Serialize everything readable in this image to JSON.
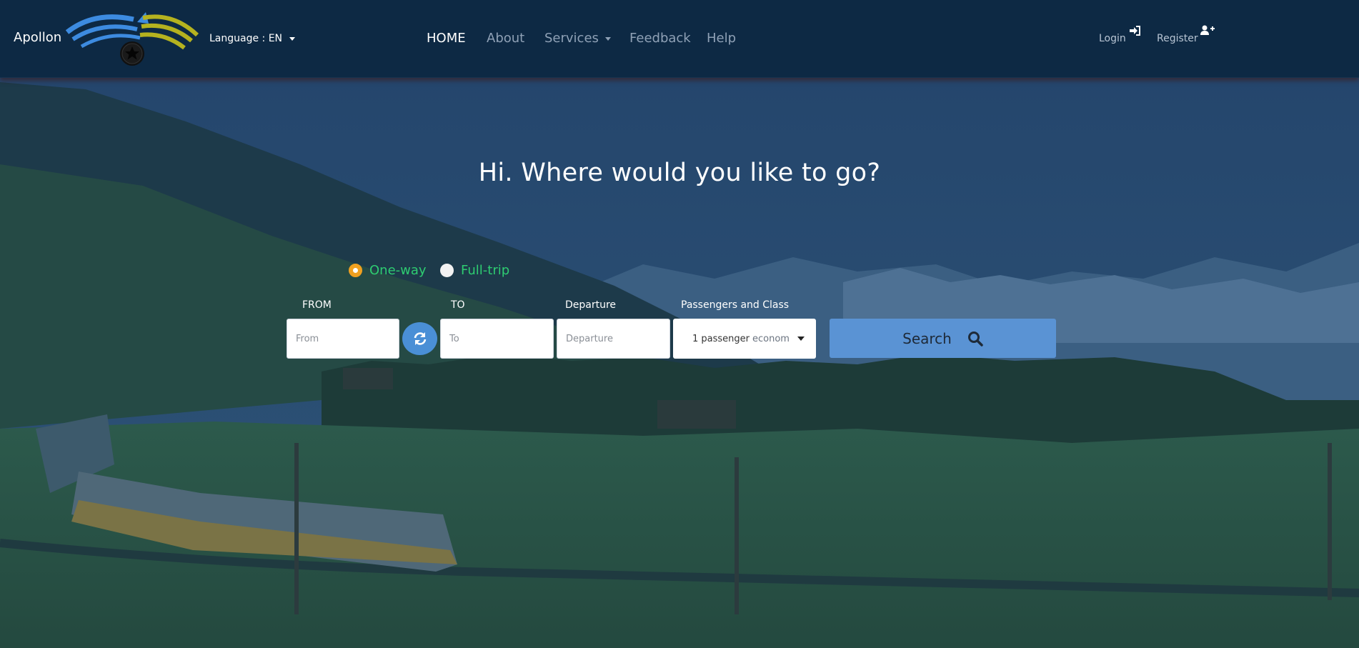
{
  "header": {
    "brand": "Apollon",
    "language_label": "Language : EN",
    "nav": [
      {
        "label": "HOME",
        "active": true
      },
      {
        "label": "About"
      },
      {
        "label": "Services",
        "has_dropdown": true
      },
      {
        "label": "Feedback"
      },
      {
        "label": "Help"
      }
    ],
    "login_label": "Login",
    "register_label": "Register"
  },
  "hero": {
    "title": "Hi. Where would you like to go?"
  },
  "search_form": {
    "trip_types": [
      {
        "label": "One-way",
        "selected": true
      },
      {
        "label": "Full-trip",
        "selected": false
      }
    ],
    "from_label": "FROM",
    "from_placeholder": "From",
    "to_label": "TO",
    "to_placeholder": "To",
    "departure_label": "Departure",
    "departure_placeholder": "Departure",
    "passengers_label": "Passengers and Class",
    "passengers_value": "1 passenger",
    "class_value": "econom",
    "search_label": "Search"
  },
  "colors": {
    "navbar_bg": "#0d2944",
    "accent_green": "#2ecc71",
    "radio_orange": "#f0a020",
    "search_button": "#5a93d4",
    "swap_button": "#4a8fd6"
  },
  "icons": [
    "login-icon",
    "register-icon",
    "swap-icon",
    "search-icon"
  ]
}
